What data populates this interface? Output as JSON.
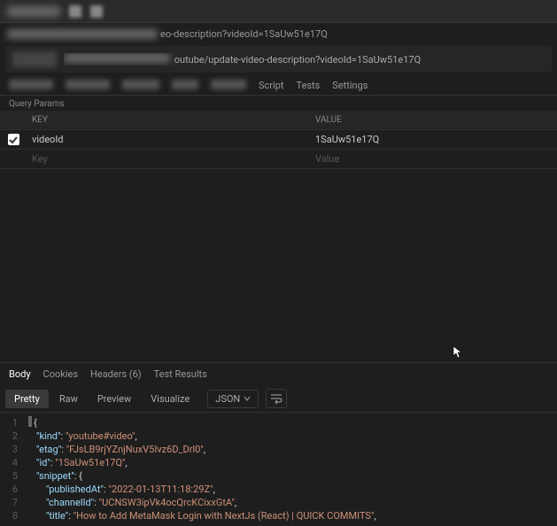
{
  "top_url_suffix": "eo-description?videoId=1SaUw51e17Q",
  "request_url_suffix": "outube/update-video-description?videoId=1SaUw51e17Q",
  "req_tabs": {
    "script": "Script",
    "tests": "Tests",
    "settings": "Settings"
  },
  "query_params_label": "Query Params",
  "param_headers": {
    "key": "KEY",
    "value": "VALUE"
  },
  "params": [
    {
      "enabled": true,
      "key": "videoId",
      "value": "1SaUw51e17Q"
    }
  ],
  "param_placeholders": {
    "key": "Key",
    "value": "Value"
  },
  "resp_tabs": {
    "body": "Body",
    "cookies": "Cookies",
    "headers": "Headers (6)",
    "test_results": "Test Results"
  },
  "view_modes": {
    "pretty": "Pretty",
    "raw": "Raw",
    "preview": "Preview",
    "visualize": "Visualize"
  },
  "format": "JSON",
  "code_lines": [
    {
      "n": 1,
      "tokens": [
        [
          "punc",
          "{"
        ]
      ]
    },
    {
      "n": 2,
      "indent": 4,
      "tokens": [
        [
          "key",
          "\"kind\""
        ],
        [
          "punc",
          ": "
        ],
        [
          "str",
          "\"youtube#video\""
        ],
        [
          "punc",
          ","
        ]
      ]
    },
    {
      "n": 3,
      "indent": 4,
      "tokens": [
        [
          "key",
          "\"etag\""
        ],
        [
          "punc",
          ": "
        ],
        [
          "str",
          "\"FJsLB9rjYZnjNuxV5Ivz6D_Drl0\""
        ],
        [
          "punc",
          ","
        ]
      ]
    },
    {
      "n": 4,
      "indent": 4,
      "tokens": [
        [
          "key",
          "\"id\""
        ],
        [
          "punc",
          ": "
        ],
        [
          "str",
          "\"1SaUw51e17Q\""
        ],
        [
          "punc",
          ","
        ]
      ]
    },
    {
      "n": 5,
      "indent": 4,
      "tokens": [
        [
          "key",
          "\"snippet\""
        ],
        [
          "punc",
          ": {"
        ]
      ]
    },
    {
      "n": 6,
      "indent": 8,
      "tokens": [
        [
          "key",
          "\"publishedAt\""
        ],
        [
          "punc",
          ": "
        ],
        [
          "str",
          "\"2022-01-13T11:18:29Z\""
        ],
        [
          "punc",
          ","
        ]
      ]
    },
    {
      "n": 7,
      "indent": 8,
      "tokens": [
        [
          "key",
          "\"channelId\""
        ],
        [
          "punc",
          ": "
        ],
        [
          "str",
          "\"UCNSW3ipVk4ocQrcKCixxGtA\""
        ],
        [
          "punc",
          ","
        ]
      ]
    },
    {
      "n": 8,
      "indent": 8,
      "tokens": [
        [
          "key",
          "\"title\""
        ],
        [
          "punc",
          ": "
        ],
        [
          "str",
          "\"How to Add MetaMask Login with NextJs (React) | QUICK COMMITS\""
        ],
        [
          "punc",
          ","
        ]
      ]
    }
  ]
}
